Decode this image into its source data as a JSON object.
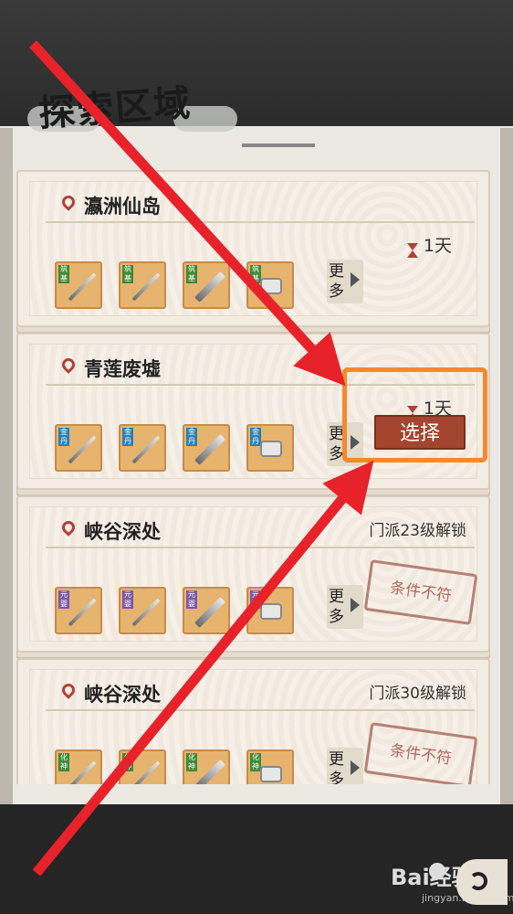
{
  "header": {
    "title": "探索区域"
  },
  "regions": [
    {
      "name": "瀛洲仙岛",
      "duration": "1天",
      "unlock": "",
      "state": "available",
      "items": [
        {
          "tag": "筑基",
          "tagColor": "#3f8a3a",
          "type": "sword"
        },
        {
          "tag": "筑基",
          "tagColor": "#3f8a3a",
          "type": "sword"
        },
        {
          "tag": "筑基",
          "tagColor": "#3f8a3a",
          "type": "broad"
        },
        {
          "tag": "筑基",
          "tagColor": "#3f8a3a",
          "type": "stone"
        }
      ]
    },
    {
      "name": "青莲废墟",
      "duration": "1天",
      "unlock": "",
      "state": "selected",
      "select_label": "选择",
      "items": [
        {
          "tag": "金丹",
          "tagColor": "#2f7fb0",
          "type": "sword"
        },
        {
          "tag": "金丹",
          "tagColor": "#2f7fb0",
          "type": "sword"
        },
        {
          "tag": "金丹",
          "tagColor": "#2f7fb0",
          "type": "broad"
        },
        {
          "tag": "金丹",
          "tagColor": "#2f7fb0",
          "type": "stone"
        }
      ]
    },
    {
      "name": "峡谷深处",
      "duration": "",
      "unlock": "门派23级解锁",
      "state": "locked",
      "stamp_label": "条件不符",
      "items": [
        {
          "tag": "元婴",
          "tagColor": "#7b58a8",
          "type": "sword"
        },
        {
          "tag": "元婴",
          "tagColor": "#7b58a8",
          "type": "sword"
        },
        {
          "tag": "元婴",
          "tagColor": "#7b58a8",
          "type": "broad"
        },
        {
          "tag": "元婴",
          "tagColor": "#7b58a8",
          "type": "stone"
        }
      ]
    },
    {
      "name": "峡谷深处",
      "duration": "",
      "unlock": "门派30级解锁",
      "state": "locked",
      "stamp_label": "条件不符",
      "items": [
        {
          "tag": "化神",
          "tagColor": "#3f8a3a",
          "type": "sword"
        },
        {
          "tag": "化神",
          "tagColor": "#3f8a3a",
          "type": "sword"
        },
        {
          "tag": "化神",
          "tagColor": "#3f8a3a",
          "type": "broad"
        },
        {
          "tag": "化神",
          "tagColor": "#3f8a3a",
          "type": "stone"
        }
      ]
    }
  ],
  "more_label": "更多",
  "watermark": {
    "brand": "Bai经验",
    "url": "jingyan.baidu.com"
  },
  "annotation": {
    "arrow_color": "#e8222a",
    "highlight_color": "#f5892b"
  }
}
